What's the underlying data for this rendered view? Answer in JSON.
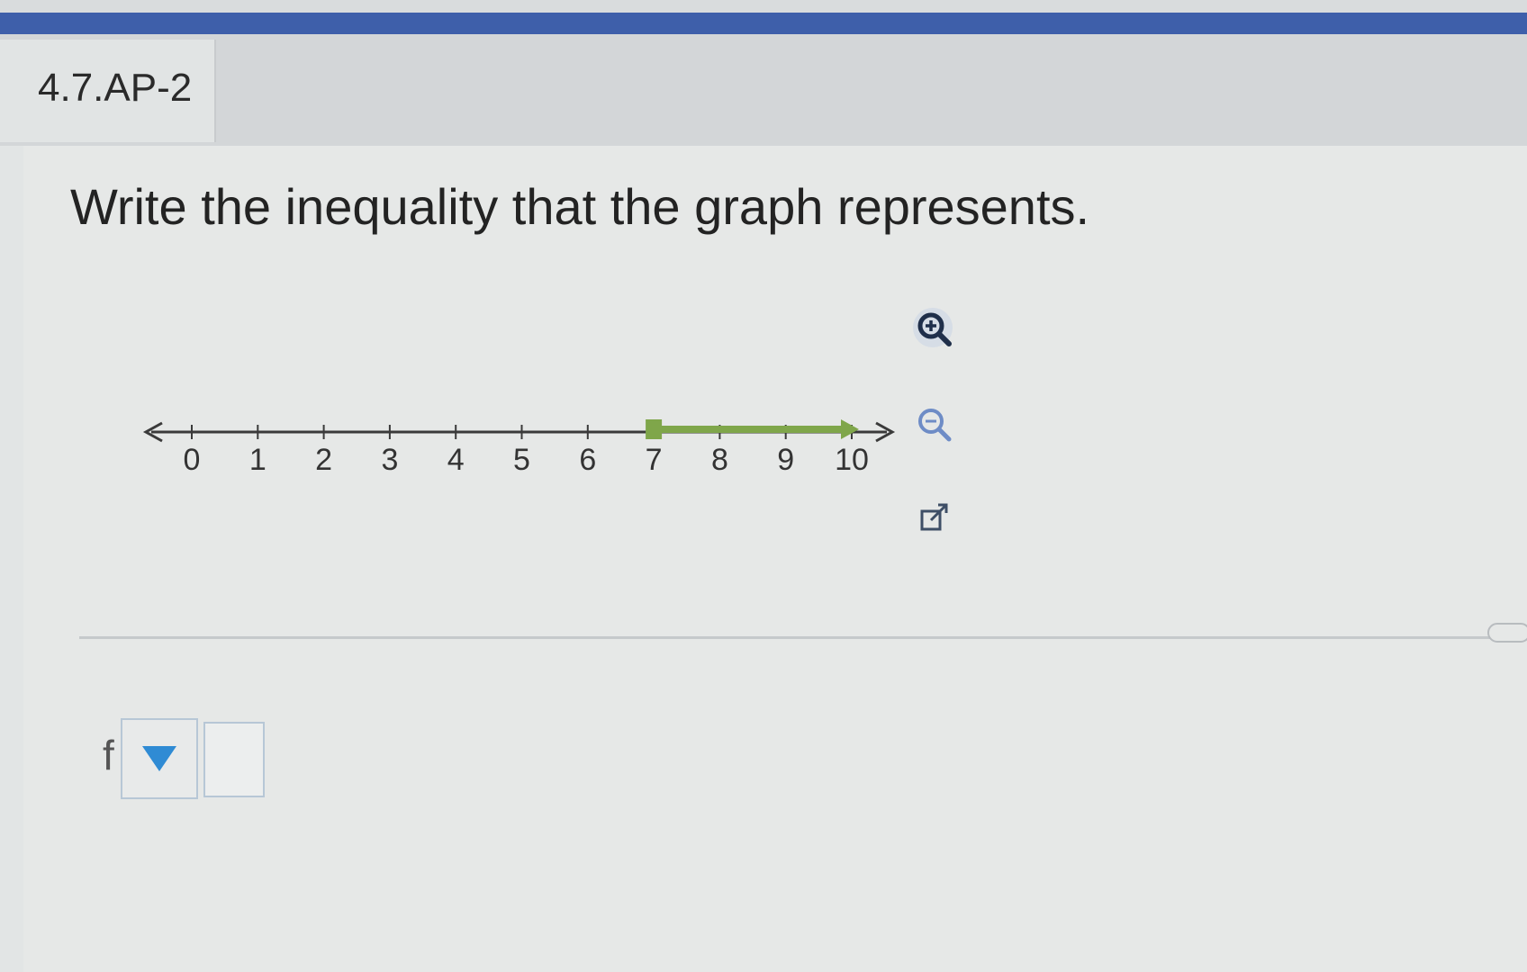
{
  "header": {
    "question_id": "4.7.AP-2"
  },
  "question": {
    "text": "Write the inequality that the graph represents."
  },
  "chart_data": {
    "type": "number-line",
    "x_range": [
      0,
      10
    ],
    "tick_values": [
      0,
      1,
      2,
      3,
      4,
      5,
      6,
      7,
      8,
      9,
      10
    ],
    "tick_labels": [
      "0",
      "1",
      "2",
      "3",
      "4",
      "5",
      "6",
      "7",
      "8",
      "9",
      "10"
    ],
    "highlighted_interval": {
      "start": 7,
      "end": 10,
      "start_closed": true,
      "continues_right": true
    },
    "axis_color": "#3a3a3a",
    "highlight_color": "#7fa64a"
  },
  "tools": {
    "zoom_in_icon": "zoom-in-icon",
    "zoom_out_icon": "zoom-out-icon",
    "popout_icon": "external-link-icon"
  },
  "answer": {
    "prefix": "f",
    "dropdown_icon": "triangle-down-icon",
    "input_value": ""
  },
  "colors": {
    "top_bar": "#3e5faa",
    "accent": "#2f8bd4"
  }
}
